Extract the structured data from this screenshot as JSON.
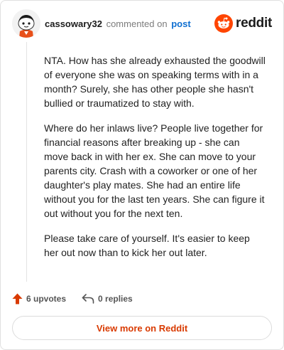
{
  "header": {
    "username": "cassowary32",
    "action": "commented on",
    "post_link": "post",
    "brand": "reddit"
  },
  "comment": {
    "paragraphs": [
      "NTA. How has she already exhausted the goodwill of everyone she was on speaking terms with in a month? Surely, she has other people she hasn't bullied or traumatized to stay with.",
      "Where do her inlaws live? People live together for financial reasons after breaking up - she can move back in with her ex. She can move to your parents city. Crash with a coworker or one of her daughter's play mates. She had an entire life without you for the last ten years. She can figure it out without you for the next ten.",
      "Please take care of yourself. It's easier to keep her out now than to kick her out later."
    ]
  },
  "actions": {
    "upvotes": "6 upvotes",
    "replies": "0 replies"
  },
  "footer": {
    "view_more": "View more on Reddit"
  },
  "colors": {
    "brand_orange": "#ff4500",
    "upvote": "#d93a00",
    "link": "#0f6fd1"
  }
}
